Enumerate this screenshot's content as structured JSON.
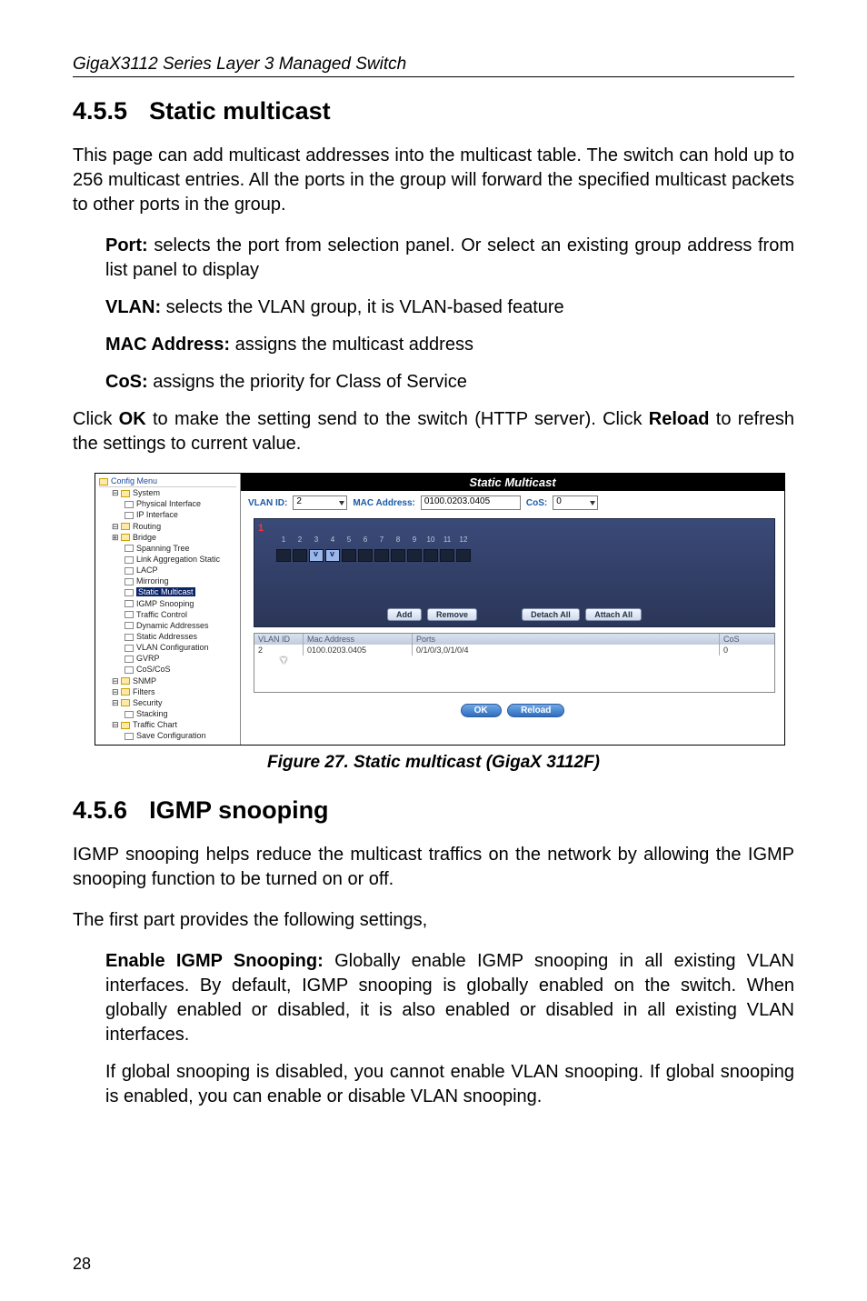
{
  "running_head": "GigaX3112 Series Layer 3 Managed Switch",
  "section455": {
    "num": "4.5.5",
    "title": "Static multicast",
    "intro": "This page can add multicast addresses into the multicast table. The switch can hold up to 256 multicast entries. All the ports in the group will forward the specified multicast packets to other ports in the group.",
    "defs": {
      "port_k": "Port:",
      "port_v": " selects the port from selection panel. Or select an existing group address from list panel to display",
      "vlan_k": "VLAN:",
      "vlan_v": " selects the VLAN group, it is VLAN-based feature",
      "mac_k": "MAC Address:",
      "mac_v": " assigns the multicast address",
      "cos_k": "CoS:",
      "cos_v": " assigns the priority for Class of Service"
    },
    "click_pre": "Click ",
    "ok_k": "OK",
    "click_mid": " to make the setting send to the switch (HTTP server). Click ",
    "reload_k": "Reload",
    "click_post": " to refresh the settings to current value."
  },
  "figure": {
    "tree": {
      "root": "Config Menu",
      "items": [
        "System",
        "Physical Interface",
        "IP Interface",
        "Routing",
        "Bridge"
      ],
      "bridge_children": [
        "Spanning Tree",
        "Link Aggregation Static",
        "LACP",
        "Mirroring",
        "Static Multicast",
        "IGMP Snooping",
        "Traffic Control",
        "Dynamic Addresses",
        "Static Addresses",
        "VLAN Configuration",
        "GVRP",
        "CoS/CoS"
      ],
      "after_bridge": [
        "SNMP",
        "Filters",
        "Security",
        "Stacking",
        "Traffic Chart",
        "Save Configuration"
      ]
    },
    "title": "Static Multicast",
    "form": {
      "vlan_label": "VLAN ID:",
      "vlan_value": "2",
      "mac_label": "MAC Address:",
      "mac_value": "0100.0203.0405",
      "cos_label": "CoS:",
      "cos_value": "0"
    },
    "marker": "1",
    "port_numbers": [
      "1",
      "2",
      "3",
      "4",
      "5",
      "6",
      "7",
      "8",
      "9",
      "10",
      "11",
      "12"
    ],
    "port_selected": [
      false,
      false,
      true,
      true,
      false,
      false,
      false,
      false,
      false,
      false,
      false,
      false
    ],
    "buttons": {
      "add": "Add",
      "remove": "Remove",
      "detach": "Detach All",
      "attach": "Attach All"
    },
    "table": {
      "head": {
        "vid": "VLAN ID",
        "mac": "Mac Address",
        "ports": "Ports",
        "cos": "CoS"
      },
      "row": {
        "vid": "2",
        "mac": "0100.0203.0405",
        "ports": "0/1/0/3,0/1/0/4",
        "cos": "0"
      }
    },
    "bottom": {
      "ok": "OK",
      "reload": "Reload"
    },
    "caption": "Figure 27. Static multicast (GigaX 3112F)"
  },
  "section456": {
    "num": "4.5.6",
    "title": "IGMP snooping",
    "p1": "IGMP snooping helps reduce the multicast traffics on the network by allowing the IGMP snooping function to be turned on or off.",
    "p2": "The first part provides the following settings,",
    "enable_k": "Enable IGMP Snooping:",
    "enable_v": " Globally enable IGMP snooping in all existing VLAN interfaces. By default, IGMP snooping is globally enabled on the switch. When globally enabled or disabled, it is also enabled or disabled in all existing VLAN interfaces.",
    "p3": "If global snooping is disabled, you cannot enable VLAN snooping. If global snooping is enabled, you can enable or disable VLAN snooping."
  },
  "page_number": "28"
}
